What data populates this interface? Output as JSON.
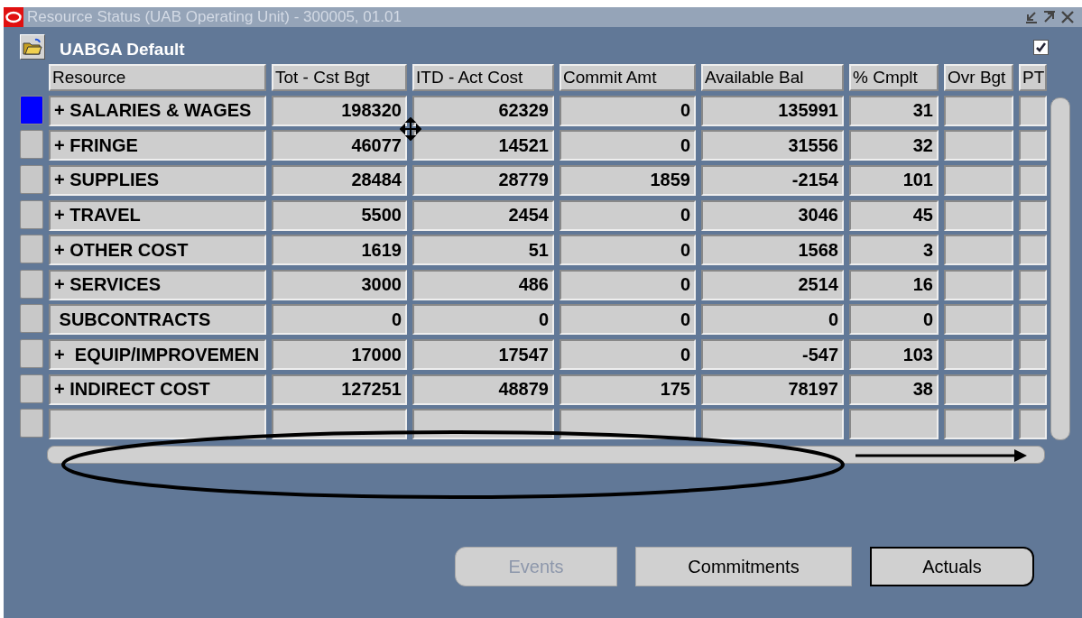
{
  "window": {
    "title": "Resource Status (UAB Operating Unit) - 300005, 01.01"
  },
  "header": {
    "title": "UABGA Default",
    "checked": true
  },
  "table": {
    "columns": [
      "Resource",
      "Tot - Cst Bgt",
      "ITD - Act Cost",
      "Commit Amt",
      "Available Bal",
      "% Cmplt",
      "Ovr Bgt",
      "PT"
    ],
    "rows": [
      {
        "selected": true,
        "cells": [
          "+ SALARIES & WAGES",
          "198320",
          "62329",
          "0",
          "135991",
          "31",
          "",
          ""
        ]
      },
      {
        "selected": false,
        "cells": [
          "+ FRINGE",
          "46077",
          "14521",
          "0",
          "31556",
          "32",
          "",
          ""
        ]
      },
      {
        "selected": false,
        "cells": [
          "+ SUPPLIES",
          "28484",
          "28779",
          "1859",
          "-2154",
          "101",
          "",
          ""
        ]
      },
      {
        "selected": false,
        "cells": [
          "+ TRAVEL",
          "5500",
          "2454",
          "0",
          "3046",
          "45",
          "",
          ""
        ]
      },
      {
        "selected": false,
        "cells": [
          "+ OTHER COST",
          "1619",
          "51",
          "0",
          "1568",
          "3",
          "",
          ""
        ]
      },
      {
        "selected": false,
        "cells": [
          "+ SERVICES",
          "3000",
          "486",
          "0",
          "2514",
          "16",
          "",
          ""
        ]
      },
      {
        "selected": false,
        "cells": [
          " SUBCONTRACTS",
          "0",
          "0",
          "0",
          "0",
          "0",
          "",
          ""
        ]
      },
      {
        "selected": false,
        "cells": [
          "+  EQUIP/IMPROVEMEN",
          "17000",
          "17547",
          "0",
          "-547",
          "103",
          "",
          ""
        ]
      },
      {
        "selected": false,
        "cells": [
          "+ INDIRECT COST",
          "127251",
          "48879",
          "175",
          "78197",
          "38",
          "",
          ""
        ]
      },
      {
        "selected": false,
        "cells": [
          "",
          "",
          "",
          "",
          "",
          "",
          "",
          ""
        ]
      }
    ]
  },
  "buttons": [
    {
      "label": "Events",
      "disabled": true
    },
    {
      "label": "Commitments",
      "disabled": false
    },
    {
      "label": "Actuals",
      "disabled": false
    }
  ]
}
